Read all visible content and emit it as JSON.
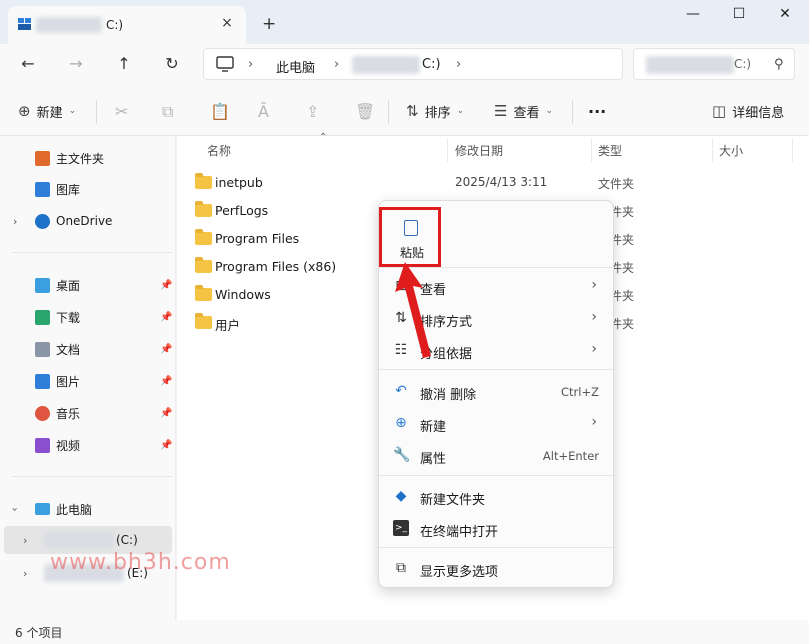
{
  "tab": {
    "title_suffix": "C:)",
    "close": "×",
    "new_tab": "+"
  },
  "window": {
    "minimize": "—",
    "maximize": "☐",
    "close": "✕"
  },
  "nav": {
    "back": "←",
    "forward": "→",
    "up": "↑",
    "refresh": "↻"
  },
  "address": {
    "crumb_pc": "此电脑",
    "crumb_drive_suffix": "C:)",
    "sep": "›"
  },
  "search": {
    "placeholder_suffix": "C:)",
    "icon": "⚲"
  },
  "commands": {
    "new": "新建",
    "sort": "排序",
    "view": "查看",
    "more": "···",
    "details": "详细信息"
  },
  "sidebar": {
    "quick": [
      {
        "label": "主文件夹",
        "icon": "home-icon",
        "color": "#e06a2c"
      },
      {
        "label": "图库",
        "icon": "gallery-icon",
        "color": "#2f7ed8"
      },
      {
        "label": "OneDrive",
        "icon": "onedrive-icon",
        "color": "#1e72c9"
      }
    ],
    "pinned": [
      {
        "label": "桌面",
        "icon": "desktop-icon",
        "color": "#3aa0df"
      },
      {
        "label": "下载",
        "icon": "download-icon",
        "color": "#2aa56e"
      },
      {
        "label": "文档",
        "icon": "documents-icon",
        "color": "#8a96a6"
      },
      {
        "label": "图片",
        "icon": "pictures-icon",
        "color": "#2f7ed8"
      },
      {
        "label": "音乐",
        "icon": "music-icon",
        "color": "#e0553f"
      },
      {
        "label": "视频",
        "icon": "videos-icon",
        "color": "#8a4fcf"
      }
    ],
    "this_pc": "此电脑",
    "drive_c_suffix": "(C:)",
    "drive_e_suffix": "(E:)"
  },
  "columns": {
    "name": "名称",
    "modified": "修改日期",
    "type": "类型",
    "size": "大小"
  },
  "files": [
    {
      "name": "inetpub",
      "date": "2025/4/13 3:11",
      "type": "文件夹"
    },
    {
      "name": "PerfLogs",
      "date": "",
      "type": "文件夹"
    },
    {
      "name": "Program Files",
      "date": "",
      "type": "文件夹"
    },
    {
      "name": "Program Files (x86)",
      "date": "",
      "type": "文件夹"
    },
    {
      "name": "Windows",
      "date": "",
      "type": "文件夹"
    },
    {
      "name": "用户",
      "date": "",
      "type": "文件夹"
    }
  ],
  "context_menu": {
    "paste": "粘贴",
    "items": [
      {
        "label": "查看",
        "icon": "grid-icon",
        "shortcut": "",
        "submenu": true
      },
      {
        "label": "排序方式",
        "icon": "sort-icon",
        "shortcut": "",
        "submenu": true
      },
      {
        "label": "分组依据",
        "icon": "group-icon",
        "shortcut": "",
        "submenu": true
      },
      {
        "label": "撤消 删除",
        "icon": "undo-icon",
        "shortcut": "Ctrl+Z",
        "submenu": false
      },
      {
        "label": "新建",
        "icon": "new-icon",
        "shortcut": "",
        "submenu": true
      },
      {
        "label": "属性",
        "icon": "wrench-icon",
        "shortcut": "Alt+Enter",
        "submenu": false
      },
      {
        "label": "新建文件夹",
        "icon": "new-folder-icon",
        "shortcut": "",
        "submenu": false
      },
      {
        "label": "在终端中打开",
        "icon": "terminal-icon",
        "shortcut": "",
        "submenu": false
      },
      {
        "label": "显示更多选项",
        "icon": "more-options-icon",
        "shortcut": "",
        "submenu": false
      }
    ]
  },
  "watermark": "www.bh3h.com",
  "status": {
    "count": "6 个项目"
  },
  "colors": {
    "accent": "#2f7ed8",
    "folder": "#f6c445",
    "annotation_red": "#e01d1d"
  }
}
